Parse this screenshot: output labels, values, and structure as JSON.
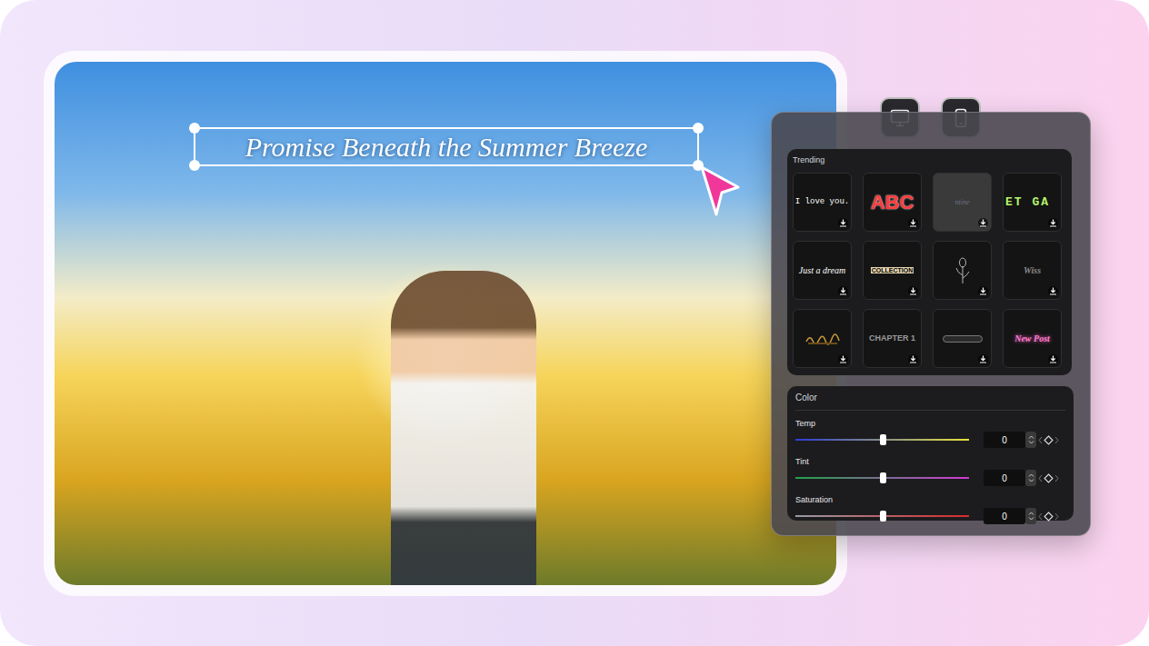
{
  "canvas": {
    "title_text": "Promise Beneath the Summer Breeze",
    "selected": true
  },
  "trending": {
    "title": "Trending",
    "items": [
      {
        "text": "I love you.",
        "kind": "mono"
      },
      {
        "text": "ABC",
        "kind": "bold-red"
      },
      {
        "text": "ntine",
        "kind": "faint-script"
      },
      {
        "text": "ET GA",
        "kind": "green-split"
      },
      {
        "text": "Just a dream",
        "kind": "script"
      },
      {
        "text": "COLLECTION",
        "kind": "collage"
      },
      {
        "text": "",
        "kind": "flower"
      },
      {
        "text": "Wiss",
        "kind": "sketch"
      },
      {
        "text": "",
        "kind": "glow"
      },
      {
        "text": "CHAPTER 1",
        "kind": "caps"
      },
      {
        "text": "",
        "kind": "bar"
      },
      {
        "text": "New Post",
        "kind": "neon"
      }
    ]
  },
  "color": {
    "title": "Color",
    "sliders": [
      {
        "label": "Temp",
        "level": 0.5,
        "value": "0",
        "color_start": "#2b3cd6",
        "color": "#e8e23a"
      },
      {
        "label": "Tint",
        "level": 0.5,
        "value": "0",
        "color_start": "#1fa34a",
        "color": "#d23ad6"
      },
      {
        "label": "Saturation",
        "level": 0.5,
        "value": "0",
        "color_start": "#9a9aa6",
        "color": "#d62b2b"
      }
    ]
  }
}
